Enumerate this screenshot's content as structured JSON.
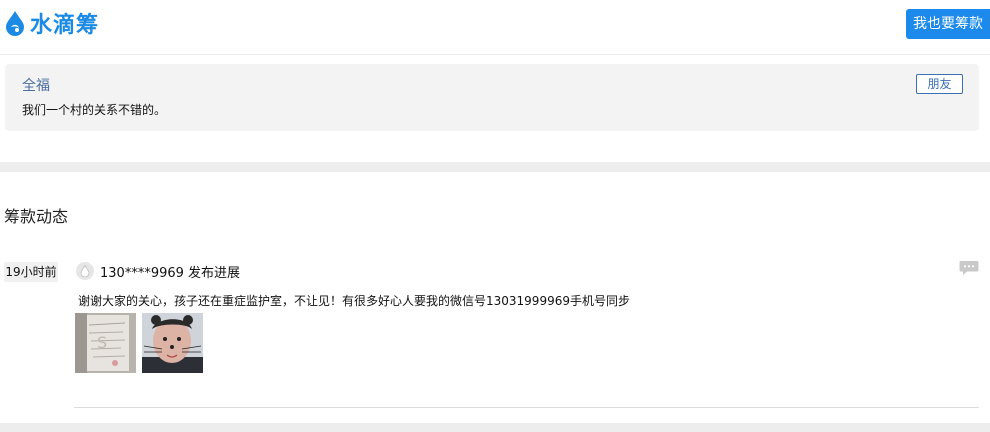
{
  "header": {
    "logo_text": "水滴筹",
    "donate_button": "我也要筹款",
    "brand_color": "#1a8ae5"
  },
  "message": {
    "sender": "全福",
    "relation": "朋友",
    "text": "我们一个村的关系不错的。"
  },
  "updates": {
    "title": "筹款动态",
    "items": [
      {
        "time": "19小时前",
        "author": "130****9969 发布进展",
        "text": "谢谢大家的关心，孩子还在重症监护室，不让见！有很多好心人要我的微信号13031999969手机号同步",
        "photos": [
          "medical-document-photo",
          "child-portrait-photo"
        ]
      }
    ]
  }
}
